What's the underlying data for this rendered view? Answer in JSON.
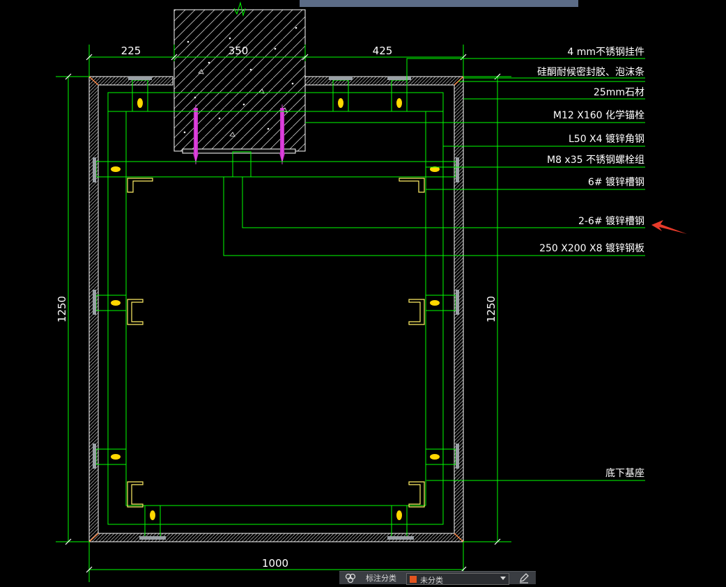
{
  "drawing": {
    "dimensions": {
      "top_left": "225",
      "top_middle": "350",
      "top_right": "425",
      "left_height": "1250",
      "right_height": "1250",
      "bottom_width": "1000"
    },
    "callouts": [
      "4 mm不锈钢挂件",
      "硅酮耐候密封胶、泡沫条",
      "25mm石材",
      "M12 X160 化学锚栓",
      "L50 X4 镀锌角钢",
      "M8 x35 不锈钢螺栓组",
      "6# 镀锌槽钢",
      "2-6# 镀锌槽钢",
      "250 X200 X8 镀锌钢板",
      "底下基座"
    ]
  },
  "toolbar": {
    "icon": "cluster-icon",
    "label": "标注分类",
    "selected": "未分类",
    "swatch_color": "#e2541f",
    "edit_icon": "edit-icon"
  },
  "colors": {
    "background": "#000000",
    "outline": "#00ff00",
    "text": "#ffffff",
    "bolt": "#cc33cc",
    "fastener": "#ffd800",
    "pointer": "#e83a2a"
  }
}
